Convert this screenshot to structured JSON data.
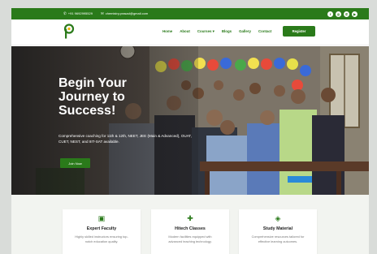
{
  "topbar": {
    "phone": "+91 9692995529",
    "email": "chemistry.prasad@gmail.com",
    "socials": [
      "f",
      "◎",
      "✆",
      "▶"
    ]
  },
  "nav": {
    "items": [
      "Home",
      "About",
      "Courses ▾",
      "Blogs",
      "Gallery",
      "Contact"
    ],
    "register_label": "Register"
  },
  "hero": {
    "title": "Begin Your Journey to Success!",
    "subtitle": "Comprehensive coaching for 11th & 12th, NEET, JEE (Main & Advanced), OUAT, CUET, NEST, and IIIT-SAT available.",
    "cta_label": "Join Now"
  },
  "features": [
    {
      "title": "Expert Faculty",
      "desc": "Highly skilled instructors ensuring top-notch education quality.",
      "icon": "teacher-icon"
    },
    {
      "title": "Hitech Classes",
      "desc": "Modern facilities equipped with advanced teaching technology.",
      "icon": "puzzle-icon"
    },
    {
      "title": "Study Material",
      "desc": "Comprehensive resources tailored for effective learning outcomes.",
      "icon": "cube-icon"
    }
  ],
  "colors": {
    "brand": "#2a7a1a",
    "hero_overlay": "#191919"
  }
}
